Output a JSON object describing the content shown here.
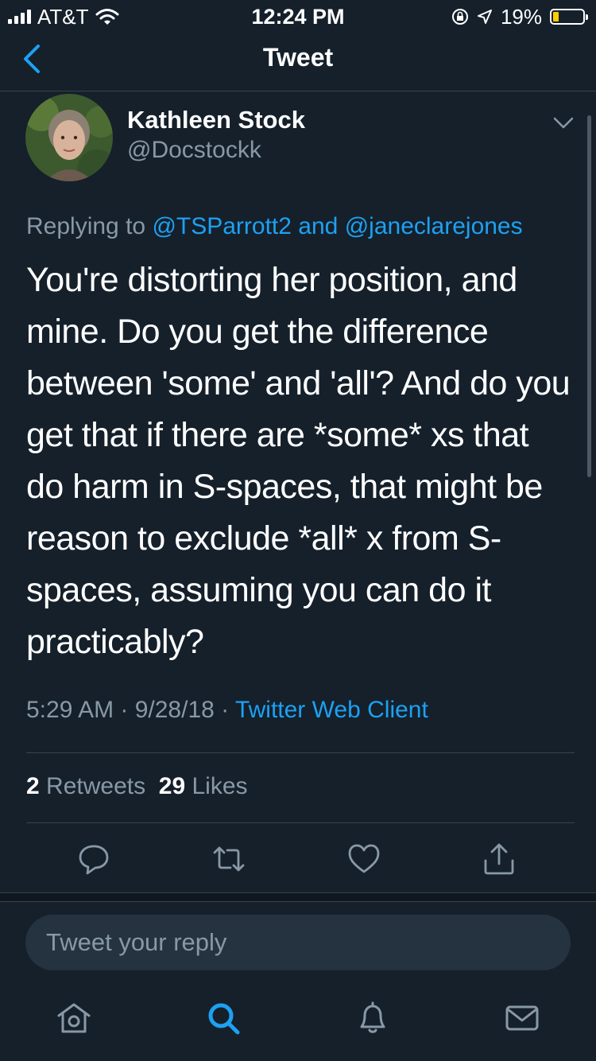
{
  "status_bar": {
    "carrier": "AT&T",
    "time": "12:24 PM",
    "battery_percent": "19%",
    "battery_level": 0.19,
    "icons": [
      "signal-icon",
      "wifi-icon",
      "orientation-lock-icon",
      "location-icon",
      "battery-icon"
    ]
  },
  "nav": {
    "title": "Tweet",
    "back_icon": "chevron-left-icon"
  },
  "tweet": {
    "author_name": "Kathleen Stock",
    "author_handle": "@Docstockk",
    "replying_prefix": "Replying to",
    "replying_to_1": "@TSParrott2",
    "replying_joiner": "and",
    "replying_to_2": "@janeclarejones",
    "text": "You're distorting her position, and mine. Do you get the difference between 'some' and 'all'? And do you get that if there are *some* xs that do harm in S-spaces, that might be reason to exclude *all* x from S-spaces, assuming you can do it practicably?",
    "timestamp": "5:29 AM · 9/28/18 ·",
    "client": "Twitter Web Client",
    "retweet_count": "2",
    "retweet_label": "Retweets",
    "like_count": "29",
    "like_label": "Likes"
  },
  "reply": {
    "placeholder": "Tweet your reply"
  },
  "tabbar": {
    "items": [
      "home-icon",
      "search-icon",
      "notifications-icon",
      "messages-icon"
    ],
    "active": "search-icon"
  },
  "colors": {
    "background": "#15202b",
    "accent": "#1da1f2",
    "secondary_text": "#8899a6",
    "divider": "#38444d",
    "battery_fill": "#ffcc00"
  }
}
